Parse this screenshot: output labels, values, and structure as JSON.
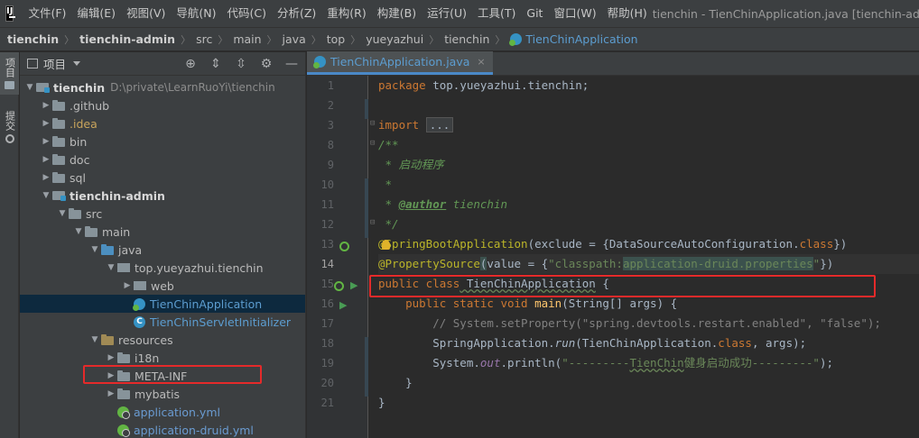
{
  "menubar": {
    "items": [
      "文件(F)",
      "编辑(E)",
      "视图(V)",
      "导航(N)",
      "代码(C)",
      "分析(Z)",
      "重构(R)",
      "构建(B)",
      "运行(U)",
      "工具(T)",
      "Git",
      "窗口(W)",
      "帮助(H)"
    ],
    "window_title": "tienchin - TienChinApplication.java [tienchin-admin]"
  },
  "breadcrumb": [
    "tienchin",
    "tienchin-admin",
    "src",
    "main",
    "java",
    "top",
    "yueyazhui",
    "tienchin",
    "TienChinApplication"
  ],
  "left_strip": [
    "项目",
    "提交"
  ],
  "project_panel": {
    "title": "项目",
    "tools": [
      "target-icon",
      "expand-all-icon",
      "collapse-all-icon",
      "gear-icon",
      "minimize-icon"
    ],
    "tree": [
      {
        "label": "tienchin",
        "path": "D:\\private\\LearnRuoYi\\tienchin"
      },
      {
        "label": ".github"
      },
      {
        "label": ".idea"
      },
      {
        "label": "bin"
      },
      {
        "label": "doc"
      },
      {
        "label": "sql"
      },
      {
        "label": "tienchin-admin"
      },
      {
        "label": "src"
      },
      {
        "label": "main"
      },
      {
        "label": "java"
      },
      {
        "label": "top.yueyazhui.tienchin"
      },
      {
        "label": "web"
      },
      {
        "label": "TienChinApplication"
      },
      {
        "label": "TienChinServletInitializer"
      },
      {
        "label": "resources"
      },
      {
        "label": "i18n"
      },
      {
        "label": "META-INF"
      },
      {
        "label": "mybatis"
      },
      {
        "label": "application.yml"
      },
      {
        "label": "application-druid.yml"
      }
    ]
  },
  "editor": {
    "tab": {
      "label": "TienChinApplication.java",
      "close": "×"
    },
    "line_numbers": [
      "1",
      "2",
      "3",
      "8",
      "9",
      "10",
      "11",
      "12",
      "13",
      "14",
      "15",
      "16",
      "17",
      "18",
      "19",
      "20",
      "21"
    ],
    "code": {
      "l1_kw": "package",
      "l1_rest": " top.yueyazhui.tienchin;",
      "l3_kw": "import",
      "l3_fold": "...",
      "l8": "/**",
      "l9": " * 启动程序",
      "l10": " *",
      "l11_pre": " * ",
      "l11_tag": "@author",
      "l11_rest": " tienchin",
      "l12": " */",
      "l13_ann": "@SpringBootApplication",
      "l13_rest1": "(exclude = {DataSourceAutoConfiguration.",
      "l13_kw": "class",
      "l13_rest2": "})",
      "l14_ann": "@PropertySource",
      "l14_p1": "(",
      "l14_p2": "value = {",
      "l14_str1": "\"classpath:",
      "l14_str2": "application-druid.properties",
      "l14_str3": "\"",
      "l14_p3": "})",
      "l15_kw": "public class",
      "l15_name": " TienChinApplication",
      "l15_rest": " {",
      "l16_kw": "    public static void",
      "l16_fn": " main",
      "l16_rest": "(String[] args) {",
      "l17": "        // System.setProperty(\"spring.devtools.restart.enabled\", \"false\");",
      "l18_a": "        SpringApplication.",
      "l18_run": "run",
      "l18_b": "(TienChinApplication.",
      "l18_kw": "class",
      "l18_c": ", args);",
      "l19_a": "        System.",
      "l19_out": "out",
      "l19_b": ".println(",
      "l19_str1": "\"---------",
      "l19_str2": "TienChin",
      "l19_str3": "健身启动成功---------\"",
      "l19_c": ");",
      "l20": "    }",
      "l21": "}"
    }
  },
  "colors": {
    "accent": "#4a88c7",
    "highlight_box": "#e52a2a"
  }
}
